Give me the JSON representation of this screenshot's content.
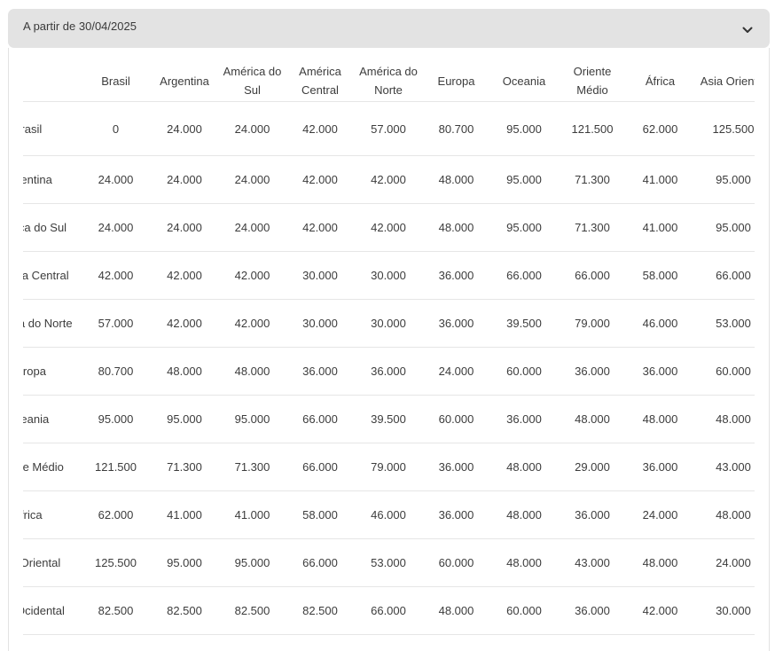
{
  "accordion": {
    "title": "A partir de 30/04/2025",
    "toggle_icon": "chevron-down-icon"
  },
  "table": {
    "columns": [
      "Brasil",
      "Argentina",
      "América do Sul",
      "América Central",
      "América do Norte",
      "Europa",
      "Oceania",
      "Oriente Médio",
      "África",
      "Asia Oriental"
    ],
    "rows": [
      {
        "label": "Brasil",
        "values": [
          "0",
          "24.000",
          "24.000",
          "42.000",
          "57.000",
          "80.700",
          "95.000",
          "121.500",
          "62.000",
          "125.500"
        ]
      },
      {
        "label": "Argentina",
        "values": [
          "24.000",
          "24.000",
          "24.000",
          "42.000",
          "42.000",
          "48.000",
          "95.000",
          "71.300",
          "41.000",
          "95.000"
        ]
      },
      {
        "label": "América do Sul",
        "values": [
          "24.000",
          "24.000",
          "24.000",
          "42.000",
          "42.000",
          "48.000",
          "95.000",
          "71.300",
          "41.000",
          "95.000"
        ]
      },
      {
        "label": "América Central",
        "values": [
          "42.000",
          "42.000",
          "42.000",
          "30.000",
          "30.000",
          "36.000",
          "66.000",
          "66.000",
          "58.000",
          "66.000"
        ]
      },
      {
        "label": "América do Norte",
        "values": [
          "57.000",
          "42.000",
          "42.000",
          "30.000",
          "30.000",
          "36.000",
          "39.500",
          "79.000",
          "46.000",
          "53.000"
        ]
      },
      {
        "label": "Europa",
        "values": [
          "80.700",
          "48.000",
          "48.000",
          "36.000",
          "36.000",
          "24.000",
          "60.000",
          "36.000",
          "36.000",
          "60.000"
        ]
      },
      {
        "label": "Oceania",
        "values": [
          "95.000",
          "95.000",
          "95.000",
          "66.000",
          "39.500",
          "60.000",
          "36.000",
          "48.000",
          "48.000",
          "48.000"
        ]
      },
      {
        "label": "Oriente Médio",
        "values": [
          "121.500",
          "71.300",
          "71.300",
          "66.000",
          "79.000",
          "36.000",
          "48.000",
          "29.000",
          "36.000",
          "43.000"
        ]
      },
      {
        "label": "África",
        "values": [
          "62.000",
          "41.000",
          "41.000",
          "58.000",
          "46.000",
          "36.000",
          "48.000",
          "36.000",
          "24.000",
          "48.000"
        ]
      },
      {
        "label": "Asia Oriental",
        "values": [
          "125.500",
          "95.000",
          "95.000",
          "66.000",
          "53.000",
          "60.000",
          "48.000",
          "43.000",
          "48.000",
          "24.000"
        ]
      },
      {
        "label": "Asia Ocidental",
        "values": [
          "82.500",
          "82.500",
          "82.500",
          "82.500",
          "66.000",
          "48.000",
          "60.000",
          "36.000",
          "42.000",
          "30.000"
        ]
      }
    ]
  }
}
